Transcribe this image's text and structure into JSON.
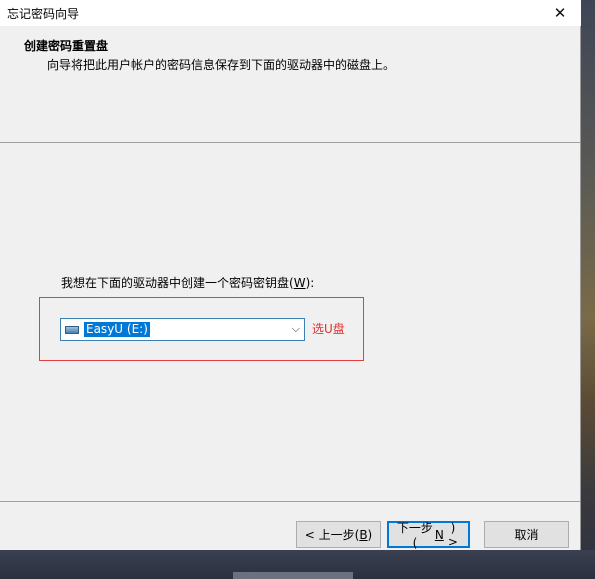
{
  "window": {
    "title": "忘记密码向导",
    "close_glyph": "✕"
  },
  "header": {
    "heading": "创建密码重置盘",
    "description": "向导将把此用户帐户的密码信息保存到下面的驱动器中的磁盘上。"
  },
  "body": {
    "prompt_before": "我想在下面的驱动器中创建一个密码密钥盘(",
    "prompt_key": "W",
    "prompt_after": "):",
    "drive_select": {
      "value": "EasyU (E:)",
      "icon": "usb-drive-icon",
      "arrow": "⌵"
    },
    "annotation": "选U盘",
    "annotation_color": "#e03030"
  },
  "buttons": {
    "back": {
      "before": "< 上一步(",
      "key": "B",
      "after": ")"
    },
    "next": {
      "before": "下一步(",
      "key": "N",
      "after": ") >"
    },
    "cancel": "取消"
  },
  "colors": {
    "accent": "#0078d7",
    "highlight_border": "#e04040"
  }
}
